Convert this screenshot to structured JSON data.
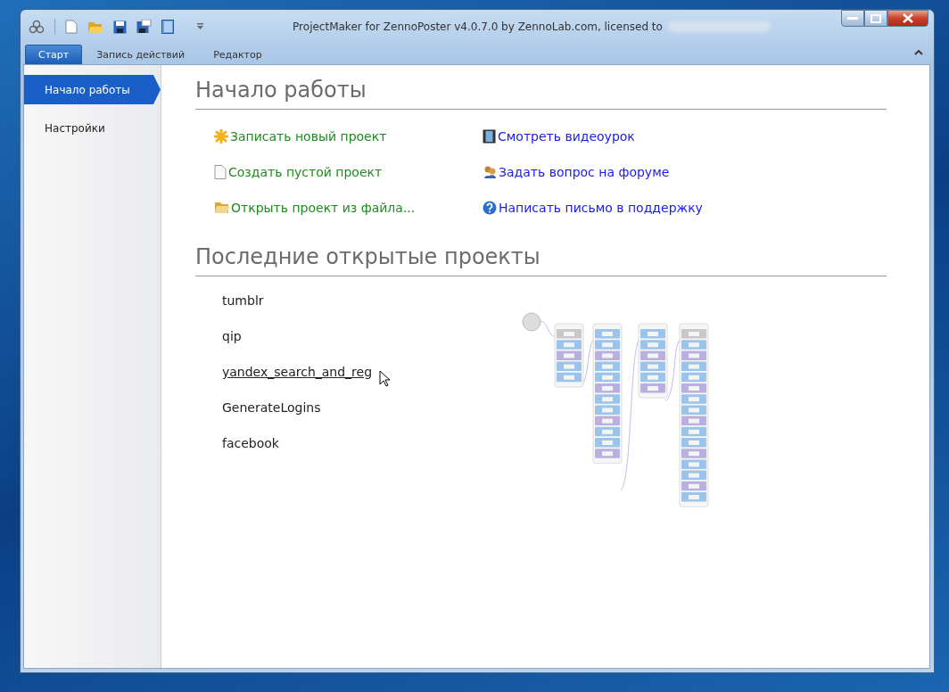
{
  "window": {
    "title": "ProjectMaker for ZennoPoster v4.0.7.0 by ZennoLab.com, licensed to",
    "redacted_email": true
  },
  "tabs": [
    {
      "label": "Старт",
      "selected": true
    },
    {
      "label": "Запись действий",
      "selected": false
    },
    {
      "label": "Редактор",
      "selected": false
    }
  ],
  "sidebar": {
    "items": [
      {
        "label": "Начало работы",
        "selected": true
      },
      {
        "label": "Настройки",
        "selected": false
      }
    ]
  },
  "start": {
    "title": "Начало работы",
    "actions": [
      {
        "label": "Записать новый проект",
        "kind": "record"
      },
      {
        "label": "Создать пустой проект",
        "kind": "blank"
      },
      {
        "label": "Открыть проект из файла...",
        "kind": "folder"
      }
    ],
    "help": [
      {
        "label": "Смотреть видеоурок",
        "kind": "video"
      },
      {
        "label": "Задать вопрос на форуме",
        "kind": "forum"
      },
      {
        "label": "Написать письмо в поддержку",
        "kind": "question"
      }
    ]
  },
  "recent": {
    "title": "Последние открытые проекты",
    "projects": [
      {
        "name": "tumblr",
        "hovered": false
      },
      {
        "name": "qip",
        "hovered": false
      },
      {
        "name": "yandex_search_and_reg",
        "hovered": true
      },
      {
        "name": "GenerateLogins",
        "hovered": false
      },
      {
        "name": "facebook",
        "hovered": false
      }
    ]
  }
}
